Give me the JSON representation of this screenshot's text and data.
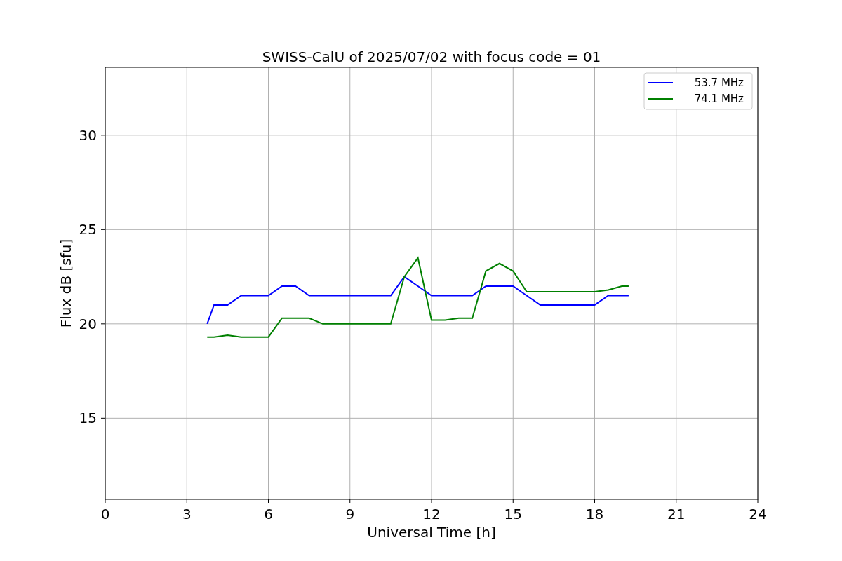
{
  "chart_data": {
    "type": "line",
    "title": "SWISS-CalU of 2025/07/02 with focus code = 01",
    "xlabel": "Universal Time [h]",
    "ylabel": "Flux dB [sfu]",
    "x": [
      3.75,
      4,
      4.5,
      5,
      5.5,
      6,
      6.5,
      7,
      7.5,
      8,
      8.5,
      9,
      9.5,
      10,
      10.5,
      11,
      11.5,
      12,
      12.5,
      13,
      13.5,
      14,
      14.5,
      15,
      15.5,
      16,
      16.5,
      17,
      17.5,
      18,
      18.5,
      19,
      19.25
    ],
    "series": [
      {
        "name": "53.7 MHz",
        "color": "#0000ff",
        "values": [
          20,
          21,
          21,
          21.5,
          21.5,
          21.5,
          22,
          22,
          21.5,
          21.5,
          21.5,
          21.5,
          21.5,
          21.5,
          21.5,
          22.5,
          22,
          21.5,
          21.5,
          21.5,
          21.5,
          22,
          22,
          22,
          21.5,
          21,
          21,
          21,
          21,
          21,
          21.5,
          21.5,
          21.5
        ]
      },
      {
        "name": "74.1 MHz",
        "color": "#008000",
        "values": [
          19.3,
          19.3,
          19.4,
          19.3,
          19.3,
          19.3,
          20.3,
          20.3,
          20.3,
          20,
          20,
          20,
          20,
          20,
          20,
          22.5,
          23.5,
          20.2,
          20.2,
          20.3,
          20.3,
          22.8,
          23.2,
          22.8,
          21.7,
          21.7,
          21.7,
          21.7,
          21.7,
          21.7,
          21.8,
          22,
          22
        ]
      }
    ],
    "xlim": [
      0,
      24
    ],
    "ylim": [
      10.7,
      33.6
    ],
    "xticks": [
      0,
      3,
      6,
      9,
      12,
      15,
      18,
      21,
      24
    ],
    "yticks": [
      15,
      20,
      25,
      30
    ],
    "grid": true,
    "legend": true
  }
}
